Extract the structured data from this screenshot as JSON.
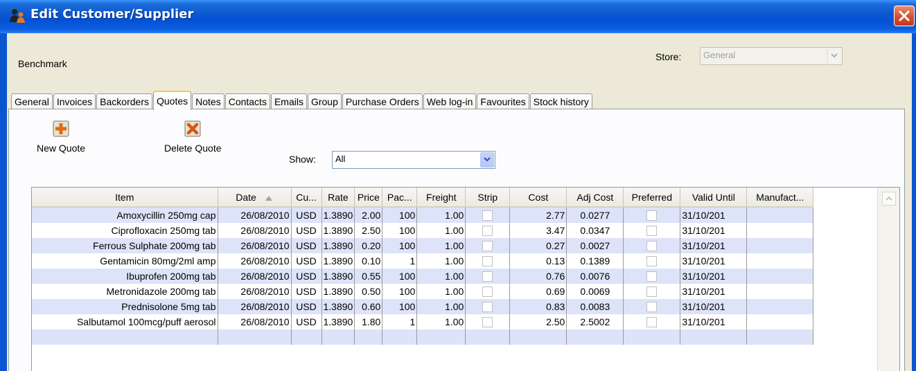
{
  "window": {
    "title": "Edit Customer/Supplier",
    "icons": {
      "app": "people-icon",
      "close": "close-icon"
    },
    "accent": "#0a56d0",
    "close_color": "#d4502e"
  },
  "customer_name": "Benchmark",
  "store": {
    "label": "Store:",
    "value": "General"
  },
  "tabs": [
    {
      "label": "General"
    },
    {
      "label": "Invoices"
    },
    {
      "label": "Backorders"
    },
    {
      "label": "Quotes",
      "active": true
    },
    {
      "label": "Notes"
    },
    {
      "label": "Contacts"
    },
    {
      "label": "Emails"
    },
    {
      "label": "Group"
    },
    {
      "label": "Purchase Orders"
    },
    {
      "label": "Web log-in"
    },
    {
      "label": "Favourites"
    },
    {
      "label": "Stock history"
    }
  ],
  "toolbar": {
    "new_quote": {
      "label": "New Quote",
      "icon": "add-icon"
    },
    "delete_quote": {
      "label": "Delete Quote",
      "icon": "delete-icon"
    },
    "show": {
      "label": "Show:",
      "value": "All"
    }
  },
  "table": {
    "columns": [
      "Item",
      "Date",
      "Cu...",
      "Rate",
      "Price",
      "Pac...",
      "Freight",
      "Strip",
      "Cost",
      "Adj Cost",
      "Preferred",
      "Valid Until",
      "Manufact..."
    ],
    "sort_column": "Date",
    "rows": [
      {
        "item": "Amoxycillin 250mg cap",
        "date": "26/08/2010",
        "cu": "USD",
        "rate": "1.3890",
        "price": "2.00",
        "pac": "100",
        "freight": "1.00",
        "strip": false,
        "cost": "2.77",
        "adj_cost": "0.0277",
        "preferred": false,
        "valid_until": "31/10/201",
        "manufact": ""
      },
      {
        "item": "Ciprofloxacin 250mg tab",
        "date": "26/08/2010",
        "cu": "USD",
        "rate": "1.3890",
        "price": "2.50",
        "pac": "100",
        "freight": "1.00",
        "strip": false,
        "cost": "3.47",
        "adj_cost": "0.0347",
        "preferred": false,
        "valid_until": "31/10/201",
        "manufact": ""
      },
      {
        "item": "Ferrous Sulphate 200mg tab",
        "date": "26/08/2010",
        "cu": "USD",
        "rate": "1.3890",
        "price": "0.20",
        "pac": "100",
        "freight": "1.00",
        "strip": false,
        "cost": "0.27",
        "adj_cost": "0.0027",
        "preferred": false,
        "valid_until": "31/10/201",
        "manufact": ""
      },
      {
        "item": "Gentamicin 80mg/2ml amp",
        "date": "26/08/2010",
        "cu": "USD",
        "rate": "1.3890",
        "price": "0.10",
        "pac": "1",
        "freight": "1.00",
        "strip": false,
        "cost": "0.13",
        "adj_cost": "0.1389",
        "preferred": false,
        "valid_until": "31/10/201",
        "manufact": ""
      },
      {
        "item": "Ibuprofen 200mg tab",
        "date": "26/08/2010",
        "cu": "USD",
        "rate": "1.3890",
        "price": "0.55",
        "pac": "100",
        "freight": "1.00",
        "strip": false,
        "cost": "0.76",
        "adj_cost": "0.0076",
        "preferred": false,
        "valid_until": "31/10/201",
        "manufact": ""
      },
      {
        "item": "Metronidazole 200mg tab",
        "date": "26/08/2010",
        "cu": "USD",
        "rate": "1.3890",
        "price": "0.50",
        "pac": "100",
        "freight": "1.00",
        "strip": false,
        "cost": "0.69",
        "adj_cost": "0.0069",
        "preferred": false,
        "valid_until": "31/10/201",
        "manufact": ""
      },
      {
        "item": "Prednisolone 5mg tab",
        "date": "26/08/2010",
        "cu": "USD",
        "rate": "1.3890",
        "price": "0.60",
        "pac": "100",
        "freight": "1.00",
        "strip": false,
        "cost": "0.83",
        "adj_cost": "0.0083",
        "preferred": false,
        "valid_until": "31/10/201",
        "manufact": ""
      },
      {
        "item": "Salbutamol 100mcg/puff aerosol",
        "date": "26/08/2010",
        "cu": "USD",
        "rate": "1.3890",
        "price": "1.80",
        "pac": "1",
        "freight": "1.00",
        "strip": false,
        "cost": "2.50",
        "adj_cost": "2.5002",
        "preferred": false,
        "valid_until": "31/10/201",
        "manufact": ""
      }
    ]
  }
}
